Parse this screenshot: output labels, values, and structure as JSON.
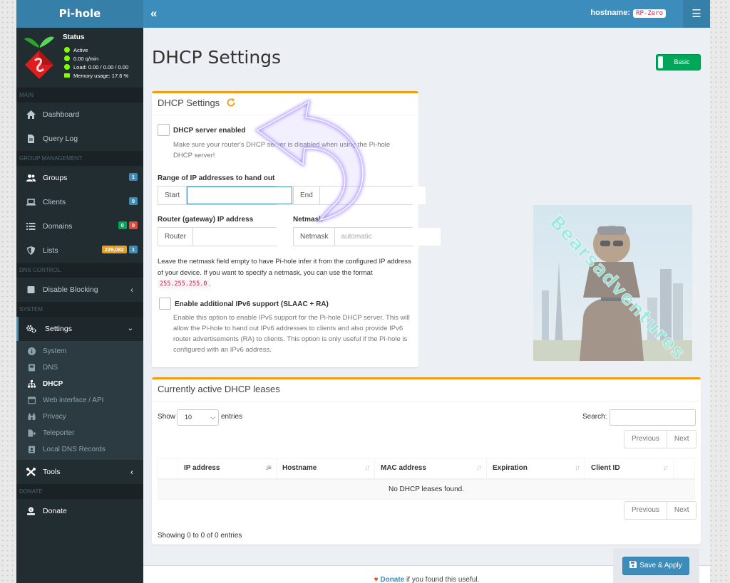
{
  "brand": "Pi-hole",
  "header": {
    "hostname_label": "hostname:",
    "hostname_value": "RP-Zero"
  },
  "status": {
    "title": "Status",
    "active": "Active",
    "rate": "0.00 q/min",
    "load": "Load: 0.00 / 0.00 / 0.00",
    "memory": "Memory usage: 17.6 %"
  },
  "sidebar": {
    "main_header": "MAIN",
    "dashboard": "Dashboard",
    "query_log": "Query Log",
    "group_header": "GROUP MANAGEMENT",
    "groups": "Groups",
    "groups_badge": "1",
    "clients": "Clients",
    "clients_badge": "0",
    "domains": "Domains",
    "domains_badge_allow": "0",
    "domains_badge_deny": "0",
    "lists": "Lists",
    "lists_badge_count": "229,082",
    "lists_badge_num": "1",
    "dns_header": "DNS CONTROL",
    "disable_blocking": "Disable Blocking",
    "system_header": "SYSTEM",
    "settings": "Settings",
    "sub": {
      "system": "System",
      "dns": "DNS",
      "dhcp": "DHCP",
      "web": "Web interface / API",
      "privacy": "Privacy",
      "teleporter": "Teleporter",
      "local_dns": "Local DNS Records"
    },
    "tools": "Tools",
    "donate_header": "DONATE",
    "donate": "Donate"
  },
  "page": {
    "title": "DHCP Settings",
    "mode_button": "Basic"
  },
  "dhcp": {
    "box_title": "DHCP Settings",
    "enabled_label": "DHCP server enabled",
    "enabled_help": "Make sure your router's DHCP server is disabled when using the Pi-hole DHCP server!",
    "range_label": "Range of IP addresses to hand out",
    "start_addon": "Start",
    "start_value": "",
    "end_addon": "End",
    "end_value": "",
    "router_label": "Router (gateway) IP address",
    "router_addon": "Router",
    "router_value": "",
    "netmask_label": "Netmask",
    "netmask_addon": "Netmask",
    "netmask_placeholder": "automatic",
    "netmask_note_1": "Leave the netmask field empty to have Pi-hole infer it from the configured IP address of your device. If you want to specify a netmask, you can use the format",
    "netmask_code": "255.255.255.0",
    "netmask_note_2": ".",
    "ipv6_label": "Enable additional IPv6 support (SLAAC + RA)",
    "ipv6_help": "Enable this option to enable IPv6 support for the Pi-hole DHCP server. This will allow the Pi-hole to hand out IPv6 addresses to clients and also provide IPv6 router advertisements (RA) to clients. This option is only useful if the Pi-hole is configured with an IPv6 address."
  },
  "watermark": "Bearsadventures",
  "leases": {
    "title": "Currently active DHCP leases",
    "show": "Show",
    "page_size": "10",
    "entries": "entries",
    "search_label": "Search:",
    "previous": "Previous",
    "next": "Next",
    "columns": [
      "IP address",
      "Hostname",
      "MAC address",
      "Expiration",
      "Client ID"
    ],
    "empty": "No DHCP leases found.",
    "info": "Showing 0 to 0 of 0 entries"
  },
  "footer": {
    "donate_link": "Donate",
    "donate_suffix": " if you found this useful."
  },
  "save_button": "Save & Apply",
  "colors": {
    "topbar": "#3c8dbc",
    "sidebar": "#222d32",
    "box_accent": "#f39c12",
    "success": "#00a65a",
    "danger": "#dd4b39",
    "status_dot": "#7FFF00"
  }
}
